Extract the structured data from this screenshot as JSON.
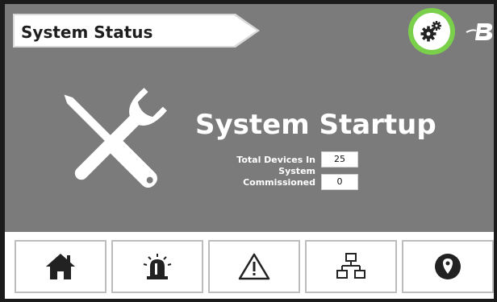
{
  "header": {
    "title": "System Status"
  },
  "main": {
    "heading": "System Startup",
    "stats": [
      {
        "label": "Total Devices In System",
        "value": "25"
      },
      {
        "label": "Commissioned",
        "value": "0"
      }
    ]
  },
  "nav": {
    "items": [
      {
        "name": "home",
        "icon": "home-icon"
      },
      {
        "name": "alarm",
        "icon": "alarm-light-icon"
      },
      {
        "name": "warning",
        "icon": "warning-icon"
      },
      {
        "name": "network",
        "icon": "network-icon"
      },
      {
        "name": "location",
        "icon": "location-pin-icon"
      }
    ]
  },
  "colors": {
    "background": "#7b7b7b",
    "settings_ring": "#7ad04a",
    "text_light": "#ffffff",
    "text_dark": "#1e1e1e"
  }
}
